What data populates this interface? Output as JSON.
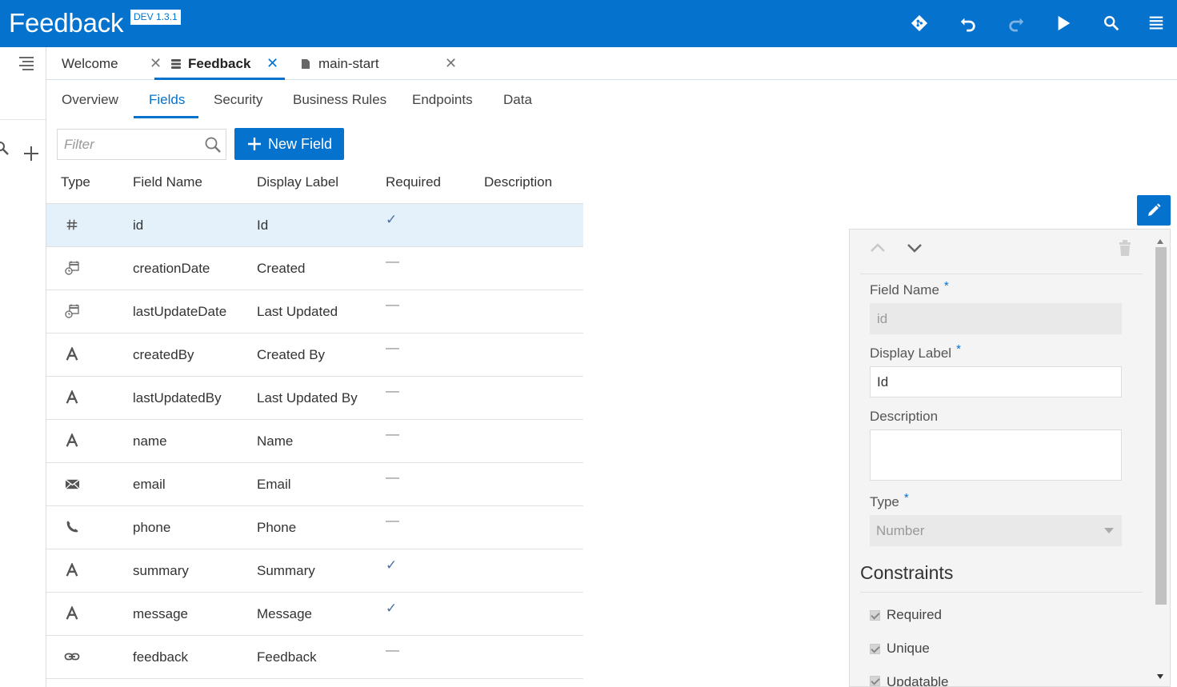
{
  "header": {
    "title": "Feedback",
    "version": "DEV 1.3.1",
    "accent_color": "#0572ce",
    "actions": [
      "git-icon",
      "undo-icon",
      "redo-icon",
      "run-icon",
      "search-icon",
      "menu-icon"
    ]
  },
  "editor_tabs": [
    {
      "label": "Welcome",
      "active": false,
      "icon": ""
    },
    {
      "label": "Feedback",
      "active": true,
      "icon": "database-icon"
    },
    {
      "label": "main-start",
      "active": false,
      "icon": "file-icon"
    }
  ],
  "sub_tabs": [
    "Overview",
    "Fields",
    "Security",
    "Business Rules",
    "Endpoints",
    "Data"
  ],
  "active_sub_tab": "Fields",
  "toolbar": {
    "filter_placeholder": "Filter",
    "new_field_label": "New Field"
  },
  "table": {
    "columns": [
      "Type",
      "Field Name",
      "Display Label",
      "Required",
      "Description"
    ],
    "rows": [
      {
        "type_icon": "number-icon",
        "field_name": "id",
        "display_label": "Id",
        "required": "✓",
        "selected": true
      },
      {
        "type_icon": "datetime-icon",
        "field_name": "creationDate",
        "display_label": "Created",
        "required": "—"
      },
      {
        "type_icon": "datetime-icon",
        "field_name": "lastUpdateDate",
        "display_label": "Last Updated",
        "required": "—"
      },
      {
        "type_icon": "text-icon",
        "field_name": "createdBy",
        "display_label": "Created By",
        "required": "—"
      },
      {
        "type_icon": "text-icon",
        "field_name": "lastUpdatedBy",
        "display_label": "Last Updated By",
        "required": "—"
      },
      {
        "type_icon": "text-icon",
        "field_name": "name",
        "display_label": "Name",
        "required": "—"
      },
      {
        "type_icon": "email-icon",
        "field_name": "email",
        "display_label": "Email",
        "required": "—"
      },
      {
        "type_icon": "phone-icon",
        "field_name": "phone",
        "display_label": "Phone",
        "required": "—"
      },
      {
        "type_icon": "text-icon",
        "field_name": "summary",
        "display_label": "Summary",
        "required": "✓"
      },
      {
        "type_icon": "text-icon",
        "field_name": "message",
        "display_label": "Message",
        "required": "✓"
      },
      {
        "type_icon": "link-icon",
        "field_name": "feedback",
        "display_label": "Feedback",
        "required": "—"
      }
    ]
  },
  "panel": {
    "field_name_label": "Field Name",
    "field_name_value": "id",
    "display_label_label": "Display Label",
    "display_label_value": "Id",
    "description_label": "Description",
    "description_value": "",
    "type_label": "Type",
    "type_value": "Number",
    "required_marker": "*",
    "constraints_title": "Constraints",
    "constraints": [
      {
        "label": "Required",
        "checked": true
      },
      {
        "label": "Unique",
        "checked": true
      },
      {
        "label": "Updatable",
        "checked": true
      }
    ]
  }
}
